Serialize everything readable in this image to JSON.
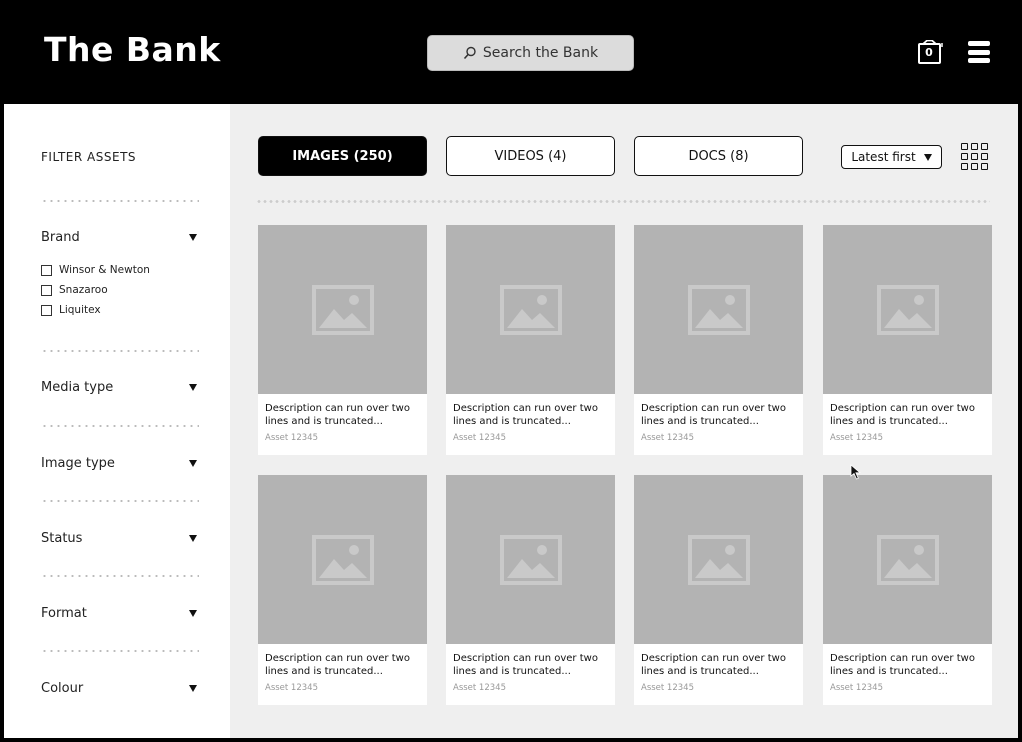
{
  "header": {
    "logo": "The Bank",
    "search_placeholder": "Search the Bank",
    "cart_count": "0"
  },
  "sidebar": {
    "title": "FILTER ASSETS",
    "brand": {
      "label": "Brand",
      "options": [
        "Winsor & Newton",
        "Snazaroo",
        "Liquitex"
      ]
    },
    "facets": [
      "Media type",
      "Image type",
      "Status",
      "Format",
      "Colour"
    ]
  },
  "main": {
    "tabs": [
      {
        "label": "IMAGES (250)",
        "active": true
      },
      {
        "label": "VIDEOS (4)",
        "active": false
      },
      {
        "label": "DOCS (8)",
        "active": false
      }
    ],
    "sort": "Latest first",
    "cards": [
      {
        "desc": "Description can run over two lines and is truncated...",
        "asset": "Asset 12345"
      },
      {
        "desc": "Description can run over two lines and is truncated...",
        "asset": "Asset 12345"
      },
      {
        "desc": "Description can run over two lines and is truncated...",
        "asset": "Asset 12345"
      },
      {
        "desc": "Description can run over two lines and is truncated...",
        "asset": "Asset 12345"
      },
      {
        "desc": "Description can run over two lines and is truncated...",
        "asset": "Asset 12345"
      },
      {
        "desc": "Description can run over two lines and is truncated...",
        "asset": "Asset 12345"
      },
      {
        "desc": "Description can run over two lines and is truncated...",
        "asset": "Asset 12345"
      },
      {
        "desc": "Description can run over two lines and is truncated...",
        "asset": "Asset 12345"
      }
    ]
  }
}
